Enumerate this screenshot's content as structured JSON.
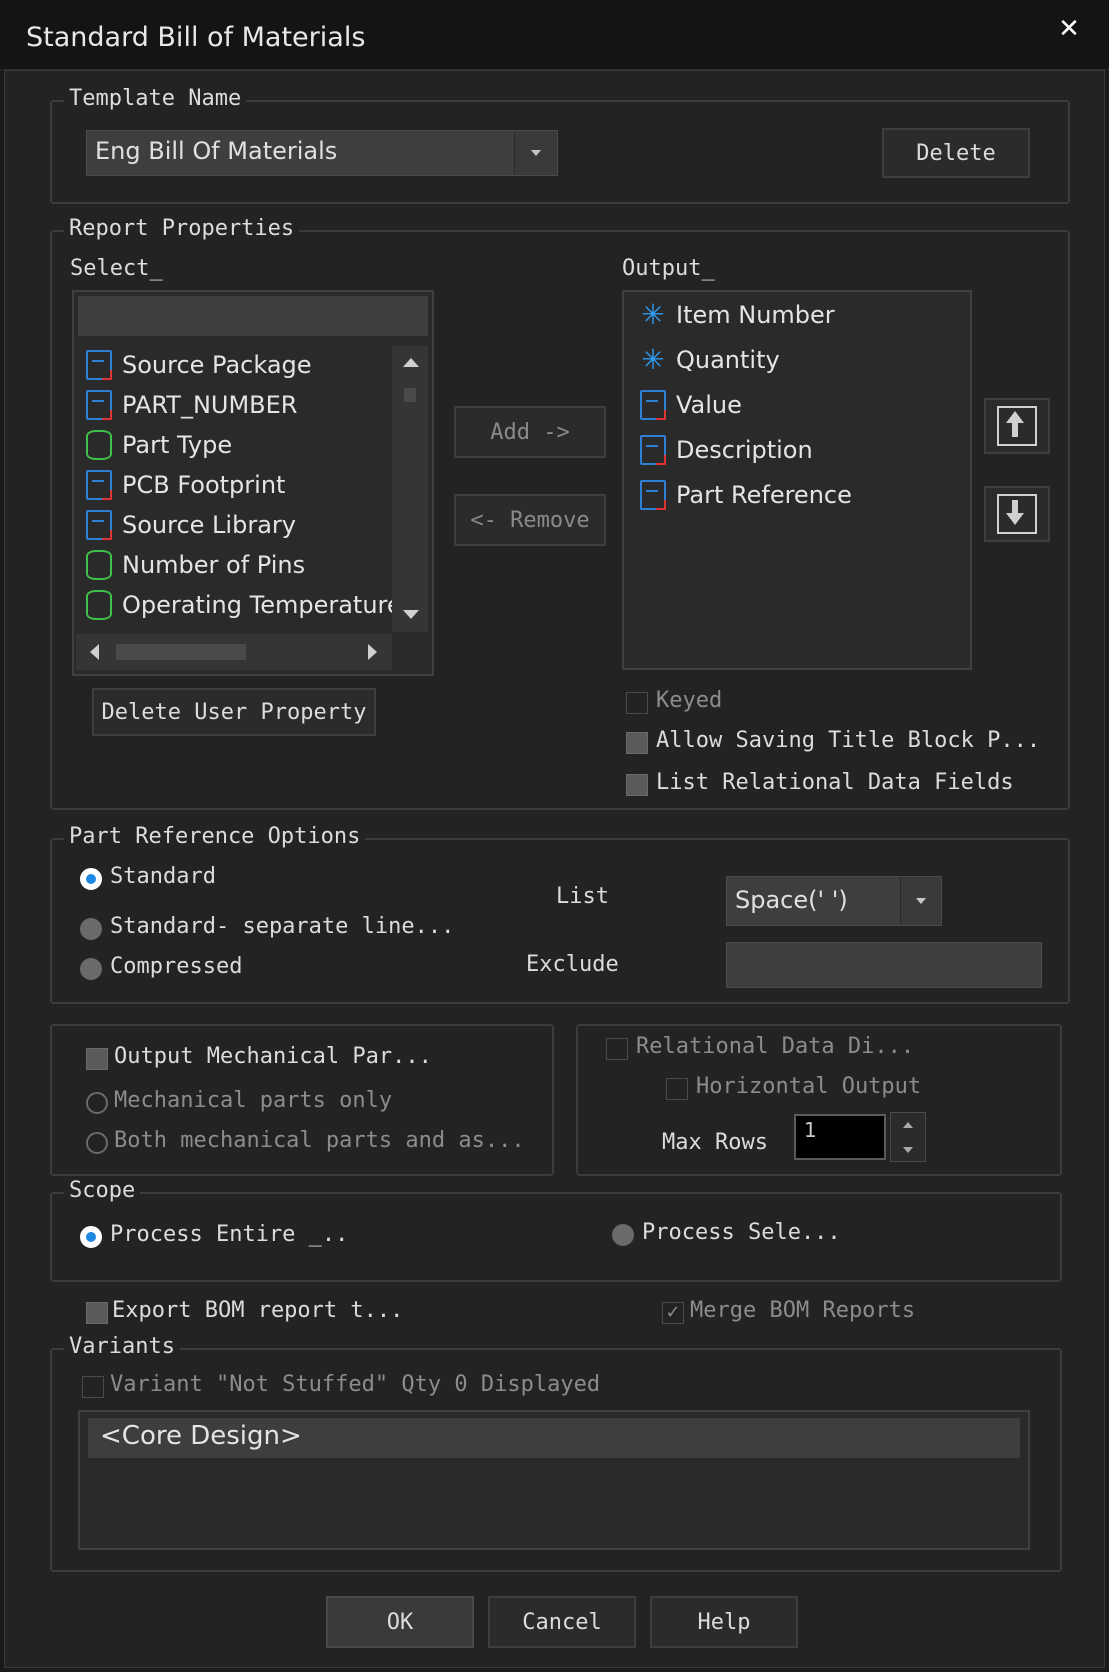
{
  "window": {
    "title": "Standard Bill of Materials",
    "close_icon": "close-icon"
  },
  "template": {
    "legend": "Template Name",
    "value": "Eng Bill Of Materials",
    "delete_label": "Delete"
  },
  "report": {
    "legend": "Report Properties",
    "select_label": "Select_",
    "output_label": "Output_",
    "select_items": [
      {
        "label": "Source Package",
        "icon": "property-doc-icon"
      },
      {
        "label": "PART_NUMBER",
        "icon": "property-doc-icon"
      },
      {
        "label": "Part Type",
        "icon": "database-icon"
      },
      {
        "label": "PCB Footprint",
        "icon": "property-doc-icon"
      },
      {
        "label": "Source Library",
        "icon": "property-doc-icon"
      },
      {
        "label": "Number of Pins",
        "icon": "database-icon"
      },
      {
        "label": "Operating Temperature M",
        "icon": "database-icon"
      }
    ],
    "output_items": [
      {
        "label": "Item Number",
        "icon": "star-icon"
      },
      {
        "label": "Quantity",
        "icon": "star-icon"
      },
      {
        "label": "Value",
        "icon": "property-doc-icon"
      },
      {
        "label": "Description",
        "icon": "property-doc-icon"
      },
      {
        "label": "Part Reference",
        "icon": "property-doc-icon"
      }
    ],
    "add_label": "Add ->",
    "remove_label": "<- Remove",
    "delete_user_property_label": "Delete User Property",
    "keyed_label": "Keyed",
    "allow_saving_label": "Allow Saving Title Block P...",
    "list_relational_label": "List Relational Data Fields"
  },
  "part_ref": {
    "legend": "Part Reference Options",
    "standard_label": "Standard",
    "standard_sep_label": "Standard- separate line...",
    "compressed_label": "Compressed",
    "list_label": "List",
    "list_value": "Space(' ')",
    "exclude_label": "Exclude",
    "exclude_value": ""
  },
  "mechanical": {
    "output_label": "Output Mechanical Par...",
    "only_label": "Mechanical parts only",
    "both_label": "Both mechanical parts and as..."
  },
  "relational": {
    "display_label": "Relational Data Di...",
    "horizontal_label": "Horizontal Output",
    "max_rows_label": "Max Rows",
    "max_rows_value": "1"
  },
  "scope": {
    "legend": "Scope",
    "entire_label": "Process Entire _..",
    "selection_label": "Process Sele..."
  },
  "export": {
    "export_label": "Export BOM report t...",
    "merge_label": "Merge BOM Reports"
  },
  "variants": {
    "legend": "Variants",
    "not_stuffed_label": "Variant \"Not Stuffed\" Qty 0 Displayed",
    "items": [
      "<Core Design>"
    ]
  },
  "buttons": {
    "ok": "OK",
    "cancel": "Cancel",
    "help": "Help"
  }
}
